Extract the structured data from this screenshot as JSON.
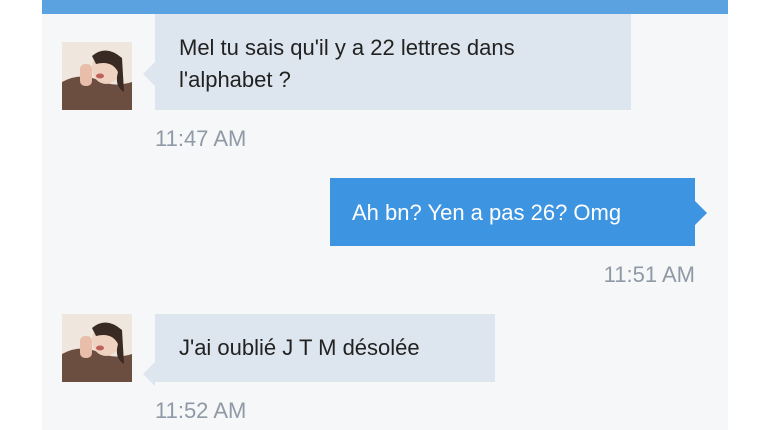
{
  "theme": {
    "header_color": "#5aa3e0",
    "incoming_bubble": "#dde5ee",
    "outgoing_bubble": "#3d94e0",
    "timestamp_color": "#8f9aa6"
  },
  "messages": [
    {
      "direction": "incoming",
      "avatar_icon": "contact-avatar-photo",
      "lines": [
        "Mel tu sais qu'il y a 22 lettres dans",
        "l'alphabet ?"
      ],
      "time": "11:47 AM"
    },
    {
      "direction": "outgoing",
      "text": "Ah bn? Yen a pas 26? Omg",
      "time": "11:51 AM"
    },
    {
      "direction": "incoming",
      "avatar_icon": "contact-avatar-photo",
      "text": "J'ai oublié J T M désolée",
      "time": "11:52 AM"
    }
  ]
}
